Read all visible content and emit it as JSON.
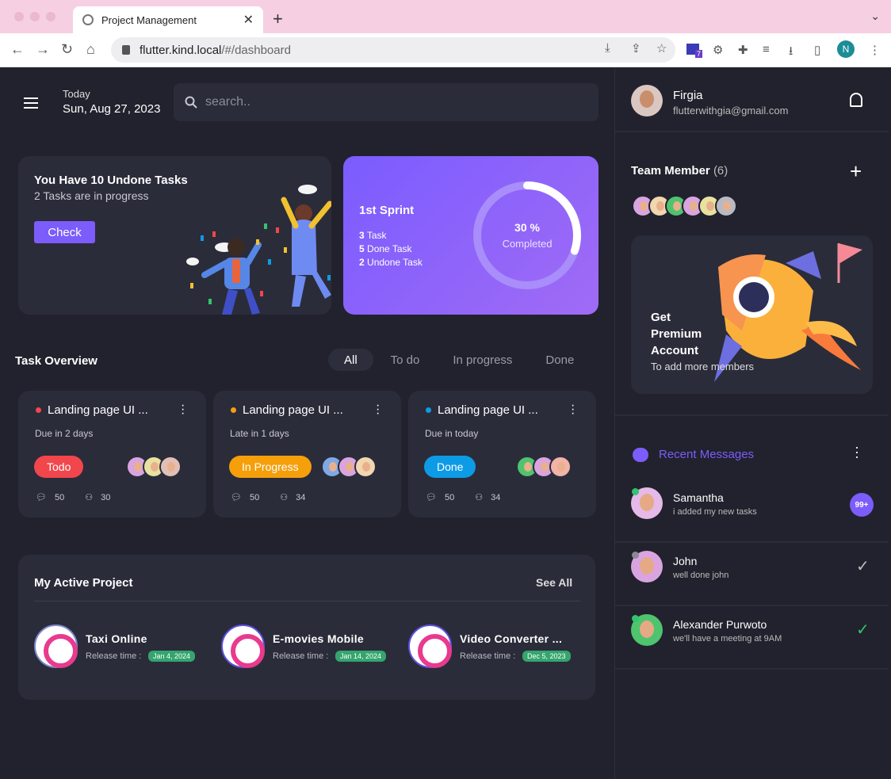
{
  "browser": {
    "tab_title": "Project Management",
    "url_host": "flutter.kind.local",
    "url_path": "/#/dashboard",
    "profile_initial": "N",
    "ext_badge": "7"
  },
  "header": {
    "today_label": "Today",
    "date": "Sun, Aug 27, 2023",
    "search_placeholder": "search.."
  },
  "summary": {
    "title": "You Have 10 Undone Tasks",
    "subtitle": "2 Tasks are in progress",
    "check_label": "Check"
  },
  "sprint": {
    "title": "1st Sprint",
    "items": [
      {
        "num": "3",
        "label": "Task"
      },
      {
        "num": "5",
        "label": "Done Task"
      },
      {
        "num": "2",
        "label": "Undone Task"
      }
    ],
    "percent_label": "30 %",
    "completed_label": "Completed",
    "progress": 0.3
  },
  "task_overview": {
    "title": "Task Overview",
    "filters": [
      "All",
      "To do",
      "In progress",
      "Done"
    ],
    "active_filter": "All",
    "cards": [
      {
        "title": "Landing page UI ...",
        "due": "Due in 2 days",
        "status": "Todo",
        "status_color": "#f2464d",
        "dot_color": "#f2464d",
        "comments": "50",
        "members": "30"
      },
      {
        "title": "Landing page UI ...",
        "due": "Late in 1 days",
        "status": "In Progress",
        "status_color": "#f59f0b",
        "dot_color": "#f59f0b",
        "comments": "50",
        "members": "34"
      },
      {
        "title": "Landing page UI ...",
        "due": "Due in today",
        "status": "Done",
        "status_color": "#0e9be6",
        "dot_color": "#0e9be6",
        "comments": "50",
        "members": "34"
      }
    ]
  },
  "projects": {
    "title": "My Active Project",
    "see_all": "See All",
    "release_label": "Release time :",
    "items": [
      {
        "name": "Taxi Online",
        "date": "Jan 4, 2024"
      },
      {
        "name": "E-movies Mobile",
        "date": "Jan 14, 2024"
      },
      {
        "name": "Video Converter ...",
        "date": "Dec 5, 2023"
      }
    ]
  },
  "user": {
    "name": "Firgia",
    "email": "flutterwithgia@gmail.com"
  },
  "team": {
    "title": "Team Member",
    "count": "(6)"
  },
  "premium": {
    "line1": "Get",
    "line2": "Premium",
    "line3": "Account",
    "subtitle": "To add more members"
  },
  "messages": {
    "title": "Recent Messages",
    "items": [
      {
        "name": "Samantha",
        "text": "i added my new tasks",
        "badge": "99+"
      },
      {
        "name": "John",
        "text": "well done john"
      },
      {
        "name": "Alexander Purwoto",
        "text": "we'll have a meeting at 9AM"
      }
    ]
  }
}
